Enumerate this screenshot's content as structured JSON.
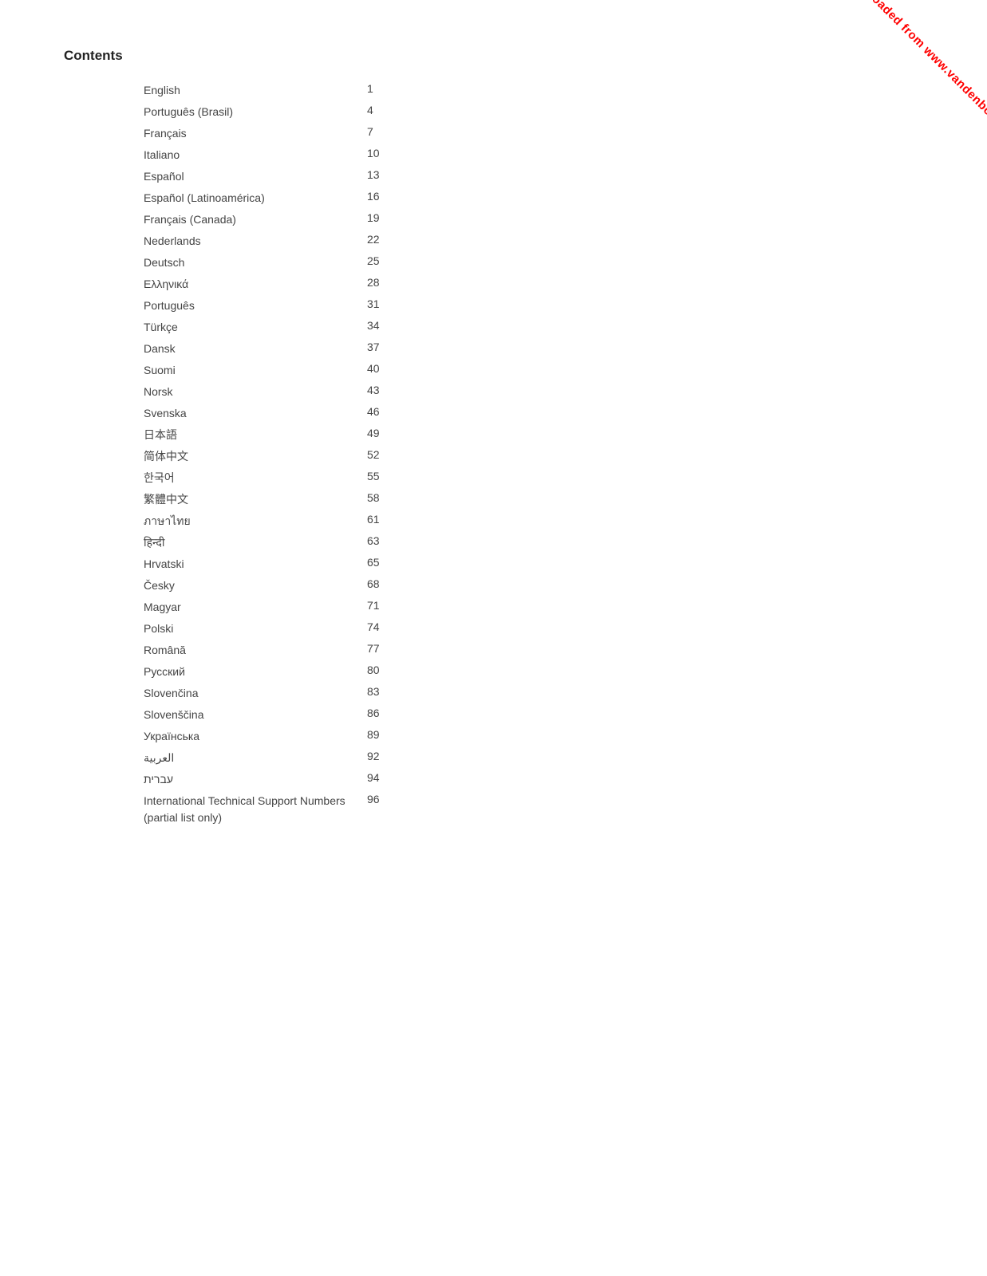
{
  "page": {
    "title": "Contents",
    "watermark": "Downloaded from www.vandenborre.be"
  },
  "toc": {
    "items": [
      {
        "language": "English",
        "page": "1"
      },
      {
        "language": "Português (Brasil)",
        "page": "4"
      },
      {
        "language": "Français",
        "page": "7"
      },
      {
        "language": "Italiano",
        "page": "10"
      },
      {
        "language": "Español",
        "page": "13"
      },
      {
        "language": "Español (Latinoamérica)",
        "page": "16"
      },
      {
        "language": "Français (Canada)",
        "page": "19"
      },
      {
        "language": "Nederlands",
        "page": "22"
      },
      {
        "language": "Deutsch",
        "page": "25"
      },
      {
        "language": "Ελληνικά",
        "page": "28"
      },
      {
        "language": "Português",
        "page": "31"
      },
      {
        "language": "Türkçe",
        "page": "34"
      },
      {
        "language": "Dansk",
        "page": "37"
      },
      {
        "language": "Suomi",
        "page": "40"
      },
      {
        "language": "Norsk",
        "page": "43"
      },
      {
        "language": "Svenska",
        "page": "46"
      },
      {
        "language": "日本語",
        "page": "49"
      },
      {
        "language": "简体中文",
        "page": "52"
      },
      {
        "language": "한국어",
        "page": "55"
      },
      {
        "language": "繁體中文",
        "page": "58"
      },
      {
        "language": "ภาษาไทย",
        "page": "61"
      },
      {
        "language": "हिन्दी",
        "page": "63"
      },
      {
        "language": "Hrvatski",
        "page": "65"
      },
      {
        "language": "Česky",
        "page": "68"
      },
      {
        "language": "Magyar",
        "page": "71"
      },
      {
        "language": "Polski",
        "page": "74"
      },
      {
        "language": "Română",
        "page": "77"
      },
      {
        "language": "Русский",
        "page": "80"
      },
      {
        "language": "Slovenčina",
        "page": "83"
      },
      {
        "language": "Slovenščina",
        "page": "86"
      },
      {
        "language": "Українська",
        "page": "89"
      },
      {
        "language": "العربية",
        "page": "92"
      },
      {
        "language": "עברית",
        "page": "94"
      },
      {
        "language": "International Technical Support Numbers (partial list only)",
        "page": "96",
        "multiline": true
      }
    ]
  }
}
